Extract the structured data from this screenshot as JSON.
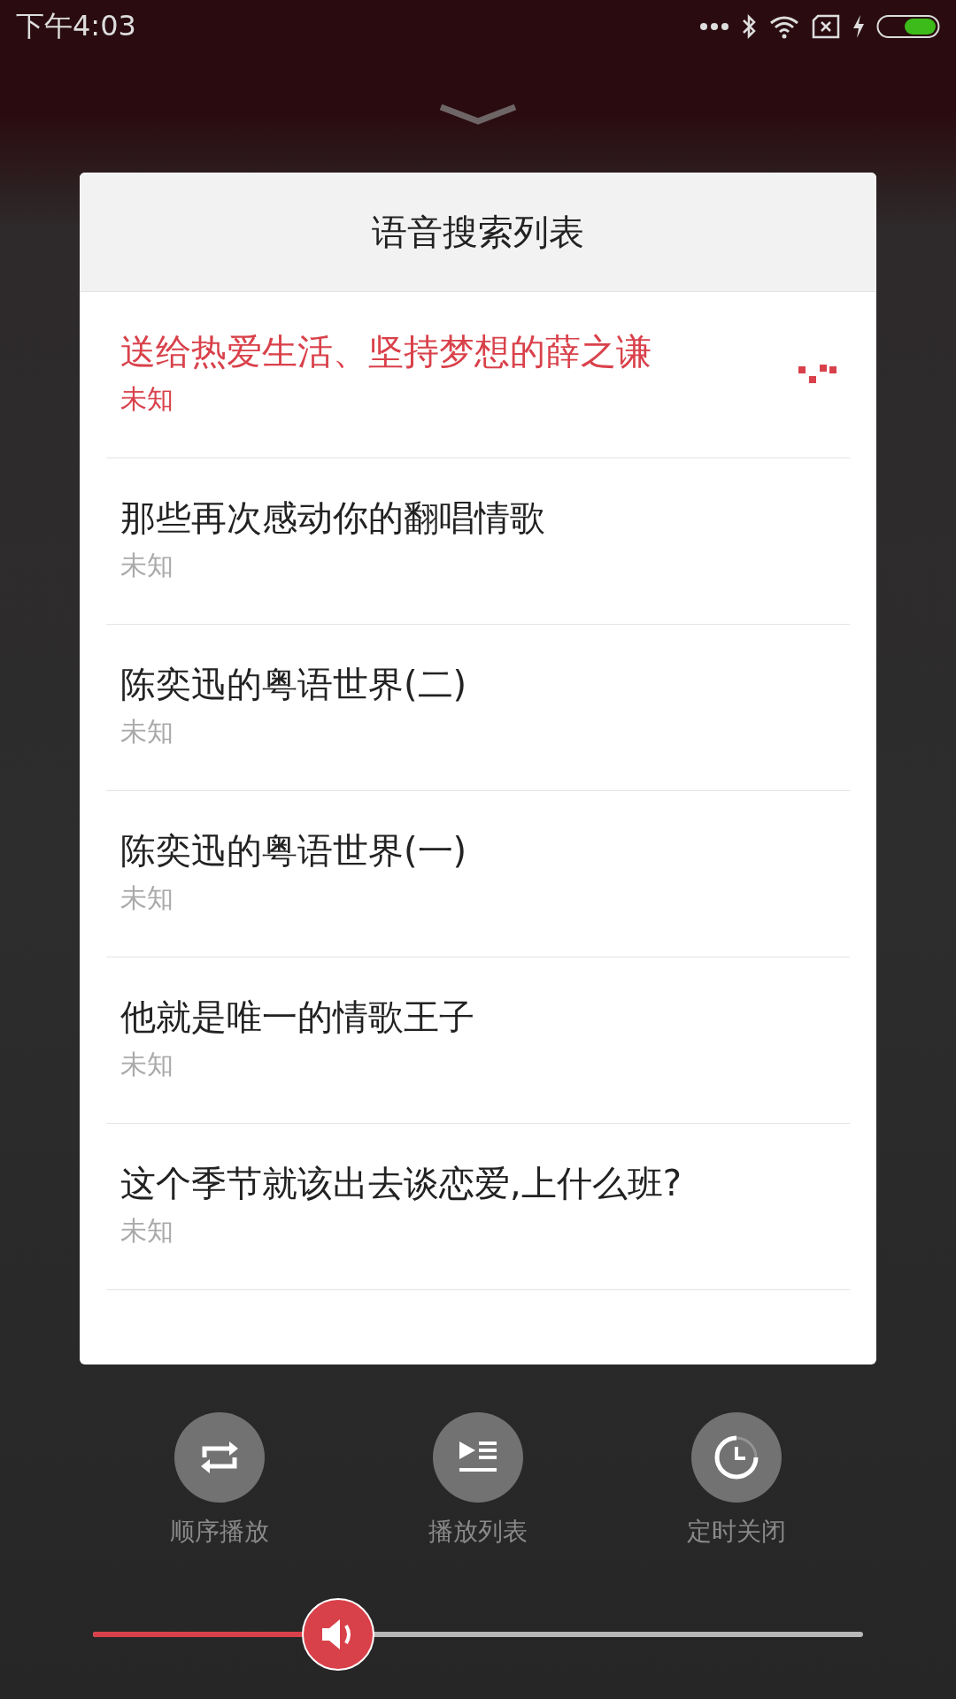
{
  "status_bar": {
    "time": "下午4:03"
  },
  "dialog": {
    "title": "语音搜索列表",
    "items": [
      {
        "title": "送给热爱生活、坚持梦想的薛之谦",
        "subtitle": "未知",
        "selected": true
      },
      {
        "title": "那些再次感动你的翻唱情歌",
        "subtitle": "未知",
        "selected": false
      },
      {
        "title": "陈奕迅的粤语世界(二)",
        "subtitle": "未知",
        "selected": false
      },
      {
        "title": "陈奕迅的粤语世界(一)",
        "subtitle": "未知",
        "selected": false
      },
      {
        "title": "他就是唯一的情歌王子",
        "subtitle": "未知",
        "selected": false
      },
      {
        "title": "这个季节就该出去谈恋爱,上什么班?",
        "subtitle": "未知",
        "selected": false
      }
    ]
  },
  "controls": [
    {
      "kind": "repeat",
      "label": "顺序播放"
    },
    {
      "kind": "playlist",
      "label": "播放列表"
    },
    {
      "kind": "timer",
      "label": "定时关闭"
    }
  ],
  "volume": {
    "level": 0.29
  }
}
